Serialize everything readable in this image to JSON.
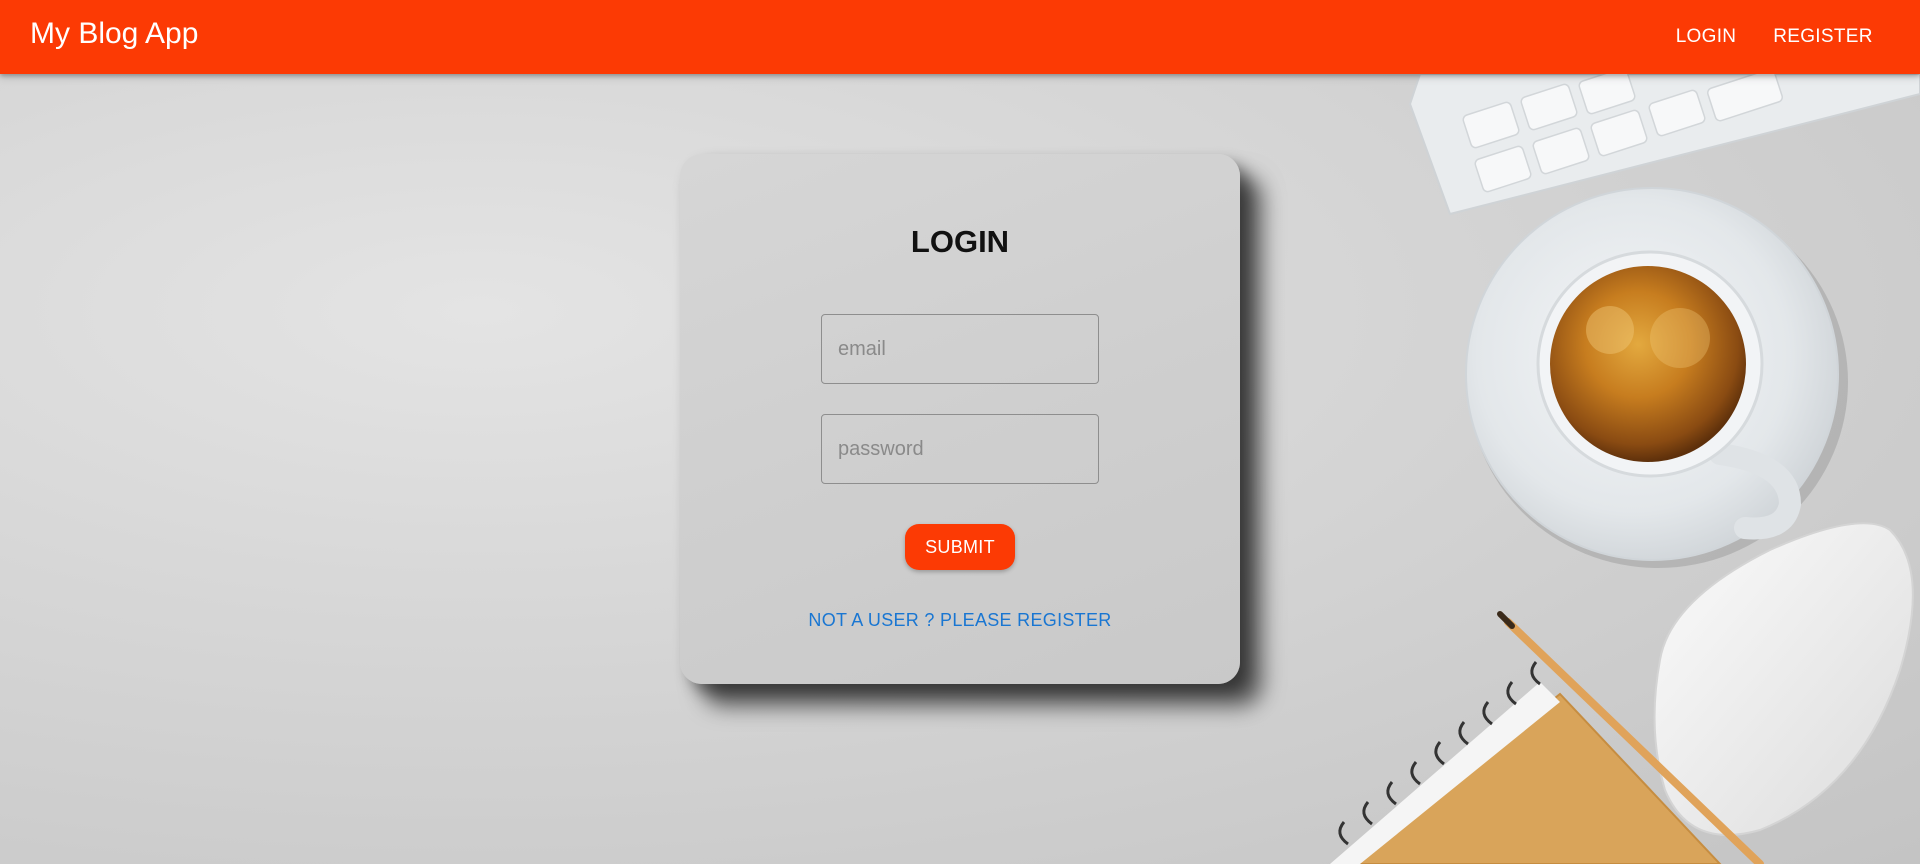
{
  "app": {
    "title": "My Blog App",
    "accent_color": "#fc3a04",
    "link_color": "#1976d2"
  },
  "nav": {
    "login_label": "LOGIN",
    "register_label": "REGISTER"
  },
  "login_card": {
    "title": "LOGIN",
    "email": {
      "placeholder": "email",
      "value": ""
    },
    "password": {
      "placeholder": "password",
      "value": ""
    },
    "submit_label": "SUBMIT",
    "register_link_label": "NOT A USER ? PLEASE REGISTER"
  },
  "background": {
    "icons": [
      "keyboard-icon",
      "coffee-cup-icon",
      "mouse-icon",
      "notebook-icon",
      "pencil-icon"
    ]
  }
}
